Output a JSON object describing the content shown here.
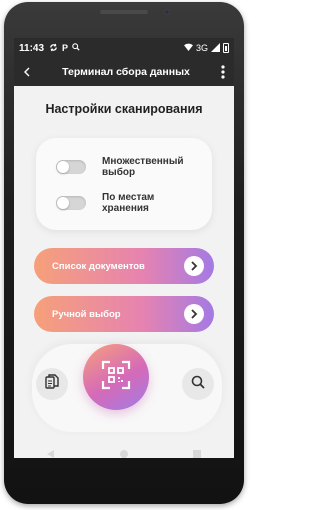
{
  "status_bar": {
    "time": "11:43",
    "icons": [
      "sync-icon",
      "parking-icon",
      "search-icon"
    ],
    "network": "3G",
    "signal_icons": [
      "wifi-icon",
      "signal-icon",
      "battery-icon"
    ]
  },
  "app_bar": {
    "back_icon": "back-arrow-icon",
    "title": "Терминал сбора данных",
    "menu_icon": "more-vertical-icon"
  },
  "page": {
    "heading": "Настройки сканирования"
  },
  "settings": {
    "toggles": [
      {
        "label": "Множественный выбор",
        "checked": false
      },
      {
        "label": "По местам хранения",
        "checked": false
      }
    ]
  },
  "actions": [
    {
      "label": "Список документов",
      "gradient": [
        "#f6a07a",
        "#e683b0",
        "#a47ae4"
      ]
    },
    {
      "label": "Ручной выбор",
      "gradient": [
        "#f6a07a",
        "#e683b0",
        "#a47ae4"
      ]
    }
  ],
  "bottom_bar": {
    "documents_icon": "documents-icon",
    "scan_icon": "qr-scan-icon",
    "search_icon": "search-icon"
  },
  "system_nav": [
    "back-triangle-icon",
    "home-circle-icon",
    "recents-square-icon"
  ],
  "colors": {
    "app_bar": "#2b2b2b",
    "screen_background": "#f2f2f3",
    "card": "#fafafa",
    "toggle_off": "#d6d6d6"
  }
}
